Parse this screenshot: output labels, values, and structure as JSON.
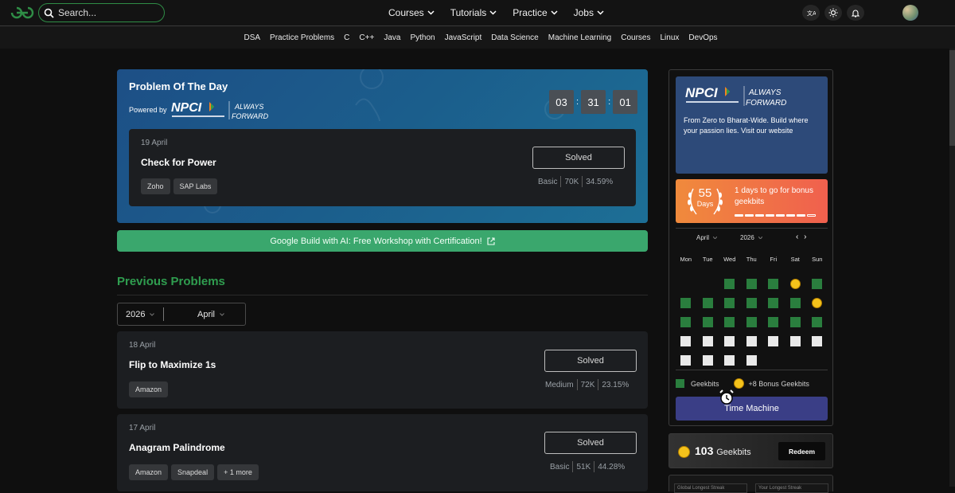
{
  "header": {
    "search_placeholder": "Search...",
    "nav": [
      "Courses",
      "Tutorials",
      "Practice",
      "Jobs"
    ]
  },
  "subnav": [
    "DSA",
    "Practice Problems",
    "C",
    "C++",
    "Java",
    "Python",
    "JavaScript",
    "Data Science",
    "Machine Learning",
    "Courses",
    "Linux",
    "DevOps"
  ],
  "potd": {
    "title": "Problem Of The Day",
    "powered_by": "Powered by",
    "timer": [
      "03",
      "31",
      "01"
    ],
    "date": "19 April",
    "name": "Check for Power",
    "tags": [
      "Zoho",
      "SAP Labs"
    ],
    "status": "Solved",
    "difficulty": "Basic",
    "submissions": "70K",
    "accuracy": "34.59%"
  },
  "banner": {
    "text": "Google Build with AI: Free Workshop with Certification!"
  },
  "previous": {
    "title": "Previous Problems",
    "year": "2026",
    "month": "April",
    "problems": [
      {
        "date": "18 April",
        "name": "Flip to Maximize 1s",
        "tags": [
          "Amazon"
        ],
        "status": "Solved",
        "difficulty": "Medium",
        "submissions": "72K",
        "accuracy": "23.15%"
      },
      {
        "date": "17 April",
        "name": "Anagram Palindrome",
        "tags": [
          "Amazon",
          "Snapdeal",
          "+ 1 more"
        ],
        "status": "Solved",
        "difficulty": "Basic",
        "submissions": "51K",
        "accuracy": "44.28%"
      }
    ]
  },
  "sidebar": {
    "ad_text": "From Zero to Bharat-Wide. Build where your passion lies. Visit our website",
    "streak_days": "55",
    "streak_days_label": "Days",
    "streak_text": "1 days to go for bonus geekbits",
    "cal_month": "April",
    "cal_year": "2026",
    "weekdays": [
      "Mon",
      "Tue",
      "Wed",
      "Thu",
      "Fri",
      "Sat",
      "Sun"
    ],
    "legend_geekbits": "Geekbits",
    "legend_bonus": "+8 Bonus Geekbits",
    "time_machine": "Time Machine",
    "geekbits_count": "103",
    "geekbits_label": "Geekbits",
    "redeem": "Redeem",
    "global_streak": "Global Longest Streak",
    "your_streak": "Your Longest Streak"
  },
  "colors": {
    "brand_green": "#2f8d46",
    "solved_cell": "#2a7e3e",
    "coin": "#f4c21b",
    "time_machine_bg": "#3a3e86",
    "banner_green": "#3aa76d"
  },
  "calendar_cells": [
    [
      "",
      "",
      "g",
      "g",
      "g",
      "c",
      "g"
    ],
    [
      "g",
      "g",
      "g",
      "g",
      "g",
      "g",
      "c"
    ],
    [
      "g",
      "g",
      "g",
      "g",
      "g",
      "g",
      "g"
    ],
    [
      "w",
      "w",
      "w",
      "w",
      "w",
      "w",
      "w"
    ],
    [
      "w",
      "w",
      "w",
      "w",
      "",
      "",
      ""
    ]
  ]
}
